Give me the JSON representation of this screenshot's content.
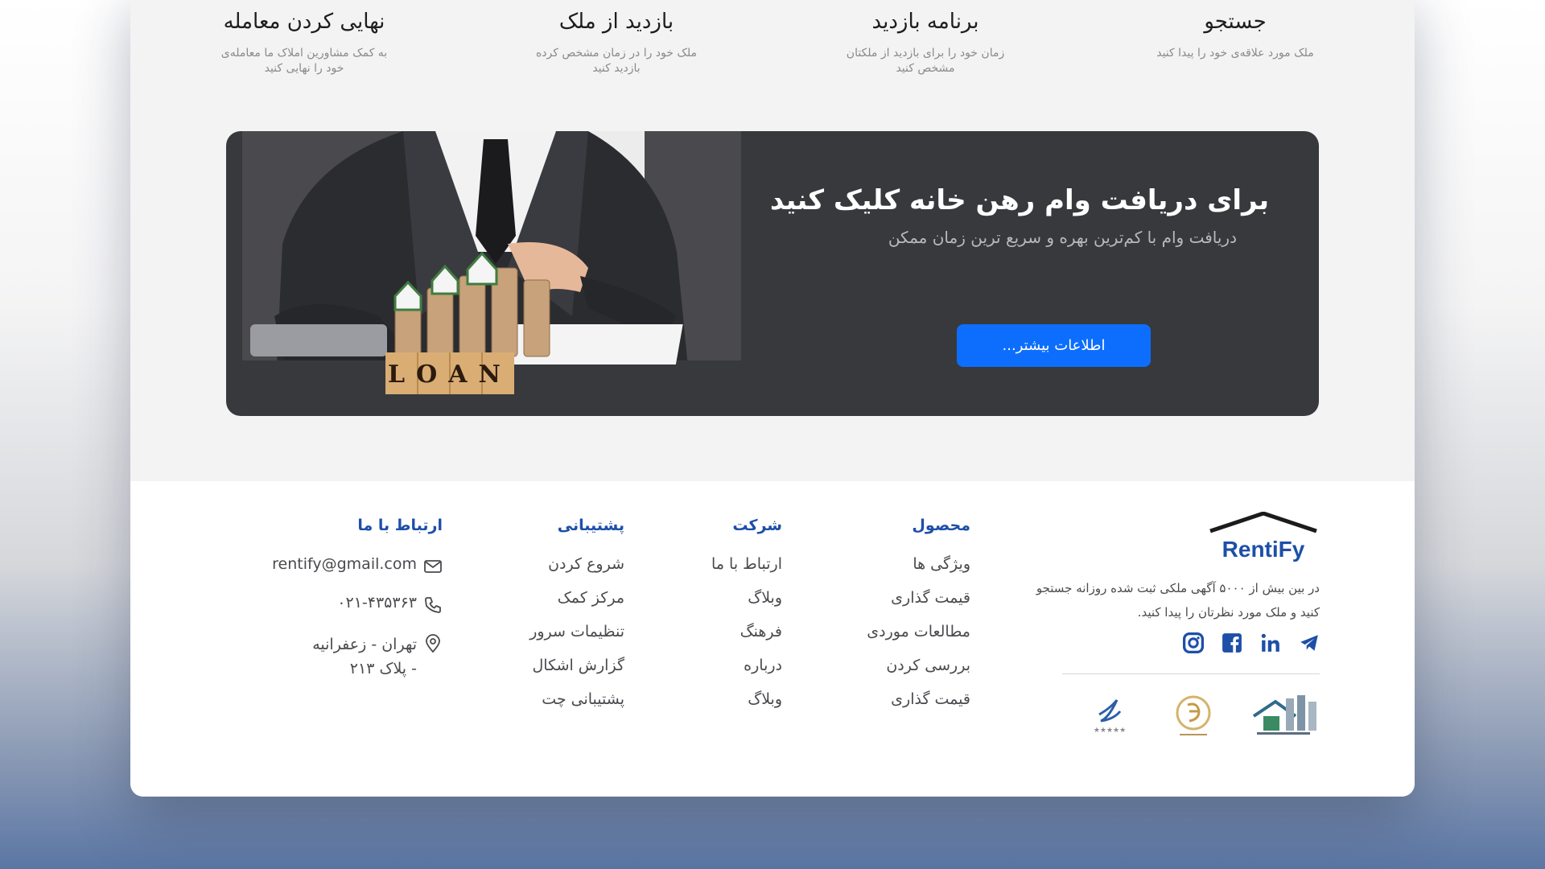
{
  "steps": [
    {
      "title": "جستجو",
      "desc": "ملک مورد علاقه‌ی خود را پیدا کنید"
    },
    {
      "title": "برنامه بازدید",
      "desc": "زمان خود را برای بازدید از ملکتان مشخص کنید"
    },
    {
      "title": "بازدید از ملک",
      "desc": "ملک خود را در زمان مشخص کرده بازدید کنید"
    },
    {
      "title": "نهایی کردن معامله",
      "desc": "به کمک مشاورین املاک ما معامله‌ی خود را نهایی کنید"
    }
  ],
  "banner": {
    "title": "برای دریافت وام رهن خانه کلیک کنید",
    "subtitle": "دریافت وام با کم‌ترین بهره و سریع ترین زمان ممکن",
    "button": "اطلاعات بیشتر...",
    "image_text": "LOAN"
  },
  "footer": {
    "logo_text": "RentiFy",
    "about": "در بین بیش از ۵۰۰۰ آگهی ملکی ثبت شده روزانه جستجو کنید و ملک مورد نظرتان را پیدا کنید.",
    "columns": [
      {
        "title": "محصول",
        "links": [
          "ویژگی ها",
          "قیمت گذاری",
          "مطالعات موردی",
          "بررسی کردن",
          "قیمت گذاری"
        ]
      },
      {
        "title": "شرکت",
        "links": [
          "ارتباط با ما",
          "وبلاگ",
          "فرهنگ",
          "درباره",
          "وبلاگ"
        ]
      },
      {
        "title": "پشتیبانی",
        "links": [
          "شروع کردن",
          "مرکز کمک",
          "تنظیمات سرور",
          "گزارش اشکال",
          "پشتیبانی چت"
        ]
      }
    ],
    "contact": {
      "title": "ارتباط با ما",
      "email": "rentify@gmail.com",
      "phone": "۰۲۱-۴۳۵۳۶۳",
      "address": "تهران - زعفرانیه - پلاک ۲۱۳"
    },
    "socials": [
      "telegram-icon",
      "linkedin-icon",
      "facebook-icon",
      "instagram-icon"
    ],
    "accent_color": "#1d4fa8",
    "button_color": "#0d6efd"
  }
}
